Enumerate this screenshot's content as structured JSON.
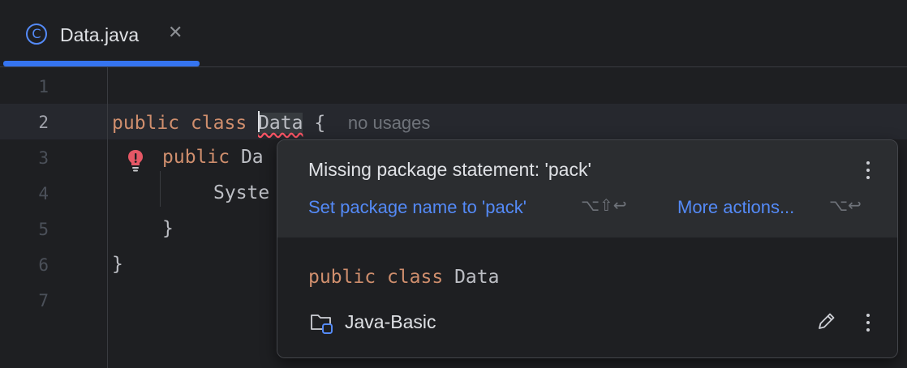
{
  "tab": {
    "icon": "class-icon",
    "icon_glyph": "C",
    "title": "Data.java",
    "close_glyph": "✕"
  },
  "editor": {
    "line_numbers": [
      "1",
      "2",
      "3",
      "4",
      "5",
      "6",
      "7"
    ],
    "lines": {
      "l2_kw1": "public",
      "l2_kw2": "class",
      "l2_name": "Data",
      "l2_brace": "{",
      "l2_hint": "no usages",
      "l3_kw": "public",
      "l3_rest": "Da",
      "l4_text": "Syste",
      "l5_text": "}",
      "l6_text": "}"
    }
  },
  "popup": {
    "title": "Missing package statement: 'pack'",
    "fix_label": "Set package name to 'pack'",
    "fix_shortcut": "⌥⇧↩",
    "more_label": "More actions...",
    "more_shortcut": "⌥↩",
    "decl_kw1": "public",
    "decl_kw2": "class",
    "decl_name": "Data",
    "module_name": "Java-Basic"
  },
  "colors": {
    "accent": "#3574f0",
    "keyword": "#cf8e6d",
    "link": "#548af7",
    "error": "#f75464",
    "background": "#1e1f22"
  }
}
